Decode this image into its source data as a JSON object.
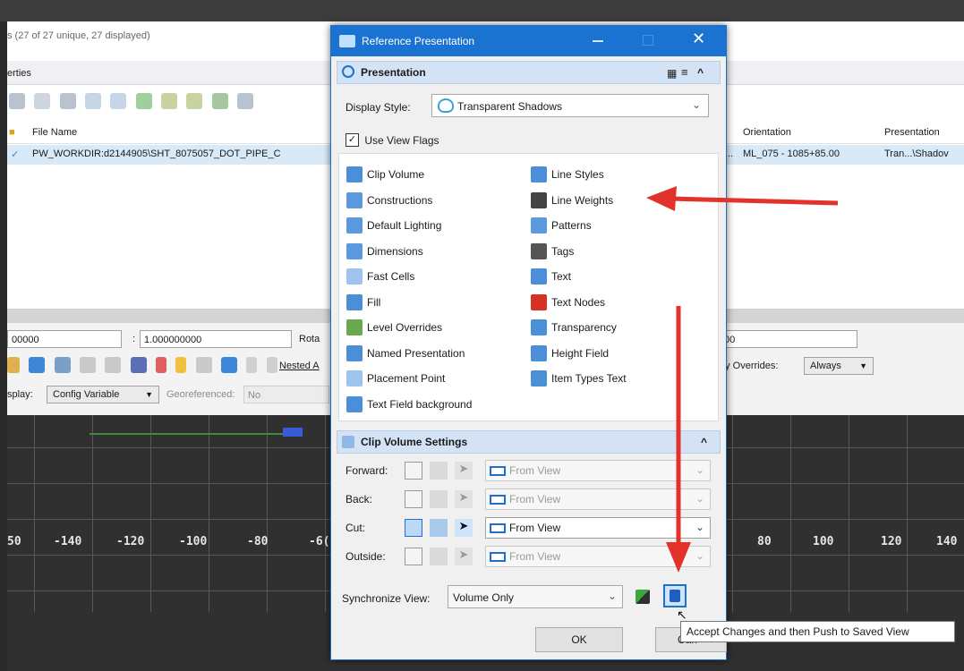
{
  "background": {
    "model_count_text": "s (27 of 27 unique, 27 displayed)",
    "properties_label": "erties",
    "columns": {
      "file_name": "File Name",
      "orientation": "Orientation",
      "presentation": "Presentation"
    },
    "row": {
      "check": "✓",
      "file_name": "PW_WORKDIR:d2144905\\SHT_8075057_DOT_PIPE_C",
      "ellipsis": "...",
      "orientation": "ML_075 - 1085+85.00",
      "presentation": "Tran...\\Shadov"
    },
    "fields": {
      "scale_left": "00000",
      "scale_colon": ":",
      "scale_right": "1.000000000",
      "rotation_label": "Rota",
      "right_value": "00"
    },
    "nested_label": "Nested A",
    "overrides_label": "ay Overrides:",
    "overrides_value": "Always",
    "display_label": "splay:",
    "display_value": "Config Variable",
    "georef_label": "Georeferenced:",
    "georef_value": "No",
    "axis_labels_left": [
      "50",
      "-140",
      "-120",
      "-100",
      "-80",
      "-6("
    ],
    "axis_labels_right": [
      "80",
      "100",
      "120",
      "140"
    ]
  },
  "dialog": {
    "title": "Reference Presentation",
    "presentation_header": "Presentation",
    "display_style_label": "Display Style:",
    "display_style_value": "Transparent Shadows",
    "use_view_flags_label": "Use View Flags",
    "flags_left": [
      {
        "label": "Clip Volume",
        "icon": "clip-volume-icon",
        "color": "#4a8fd8"
      },
      {
        "label": "Constructions",
        "icon": "constructions-icon",
        "color": "#5b9ae0"
      },
      {
        "label": "Default Lighting",
        "icon": "default-lighting-icon",
        "color": "#5b9ae0"
      },
      {
        "label": "Dimensions",
        "icon": "dimensions-icon",
        "color": "#5b9ae0"
      },
      {
        "label": "Fast Cells",
        "icon": "fast-cells-icon",
        "color": "#9ec4ee"
      },
      {
        "label": "Fill",
        "icon": "fill-icon",
        "color": "#4a8fd8"
      },
      {
        "label": "Level Overrides",
        "icon": "level-overrides-icon",
        "color": "#6aa84f"
      },
      {
        "label": "Named Presentation",
        "icon": "named-presentation-icon",
        "color": "#4a8fd8"
      },
      {
        "label": "Placement Point",
        "icon": "placement-point-icon",
        "color": "#9ec4ee"
      },
      {
        "label": "Text Field background",
        "icon": "text-field-background-icon",
        "color": "#4a8fd8"
      }
    ],
    "flags_right": [
      {
        "label": "Line Styles",
        "icon": "line-styles-icon",
        "color": "#4a8fd8"
      },
      {
        "label": "Line Weights",
        "icon": "line-weights-icon",
        "color": "#444444"
      },
      {
        "label": "Patterns",
        "icon": "patterns-icon",
        "color": "#5b9ae0"
      },
      {
        "label": "Tags",
        "icon": "tags-icon",
        "color": "#555555"
      },
      {
        "label": "Text",
        "icon": "text-icon",
        "color": "#4a8fd8"
      },
      {
        "label": "Text Nodes",
        "icon": "text-nodes-icon",
        "color": "#d93025"
      },
      {
        "label": "Transparency",
        "icon": "transparency-icon",
        "color": "#4a8fd8"
      },
      {
        "label": "Height Field",
        "icon": "height-field-icon",
        "color": "#4a8fd8"
      },
      {
        "label": "Item Types Text",
        "icon": "item-types-text-icon",
        "color": "#4a8fd8"
      }
    ],
    "clip_header": "Clip Volume Settings",
    "clip_rows": [
      {
        "label": "Forward:",
        "value": "From View",
        "enabled": false
      },
      {
        "label": "Back:",
        "value": "From View",
        "enabled": false
      },
      {
        "label": "Cut:",
        "value": "From View",
        "enabled": true
      },
      {
        "label": "Outside:",
        "value": "From View",
        "enabled": false
      }
    ],
    "sync_label": "Synchronize View:",
    "sync_value": "Volume Only",
    "ok_label": "OK",
    "cancel_label": "Can"
  },
  "tooltip": "Accept Changes and then Push to Saved View",
  "colors": {
    "accent": "#1a73d1",
    "arrow": "#e2322c"
  }
}
